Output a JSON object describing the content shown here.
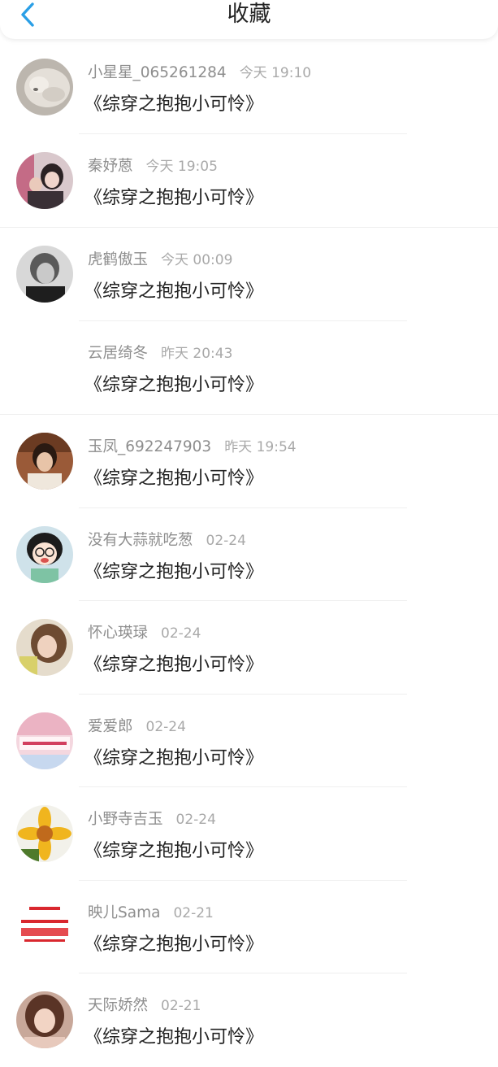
{
  "header": {
    "title": "收藏",
    "back_icon": "chevron-left-icon",
    "accent": "#2a9fe6"
  },
  "favorites": [
    {
      "name": "小星星_065261284",
      "time": "今天 19:10",
      "title": "《综穿之抱抱小可怜》",
      "avatar": "cat-photo"
    },
    {
      "name": "秦妤蒽",
      "time": "今天 19:05",
      "title": "《综穿之抱抱小可怜》",
      "avatar": "girl-photo"
    },
    {
      "name": "虎鹤傲玉",
      "time": "今天 00:09",
      "title": "《综穿之抱抱小可怜》",
      "avatar": "grayscale-portrait"
    },
    {
      "name": "云居绮冬",
      "time": "昨天 20:43",
      "title": "《综穿之抱抱小可怜》",
      "avatar": ""
    },
    {
      "name": "玉凤_692247903",
      "time": "昨天 19:54",
      "title": "《综穿之抱抱小可怜》",
      "avatar": "woman-photo"
    },
    {
      "name": "没有大蒜就吃葱",
      "time": "02-24",
      "title": "《综穿之抱抱小可怜》",
      "avatar": "cartoon-girl"
    },
    {
      "name": "怀心瑛琭",
      "time": "02-24",
      "title": "《综穿之抱抱小可怜》",
      "avatar": "woman-selfie"
    },
    {
      "name": "爱爱郎",
      "time": "02-24",
      "title": "《综穿之抱抱小可怜》",
      "avatar": "pink-text-photo"
    },
    {
      "name": "小野寺吉玉",
      "time": "02-24",
      "title": "《综穿之抱抱小可怜》",
      "avatar": "yellow-flower"
    },
    {
      "name": "映儿Sama",
      "time": "02-21",
      "title": "《综穿之抱抱小可怜》",
      "avatar": "red-logo"
    },
    {
      "name": "天际娇然",
      "time": "02-21",
      "title": "《综穿之抱抱小可怜》",
      "avatar": "woman-photo-2"
    }
  ]
}
